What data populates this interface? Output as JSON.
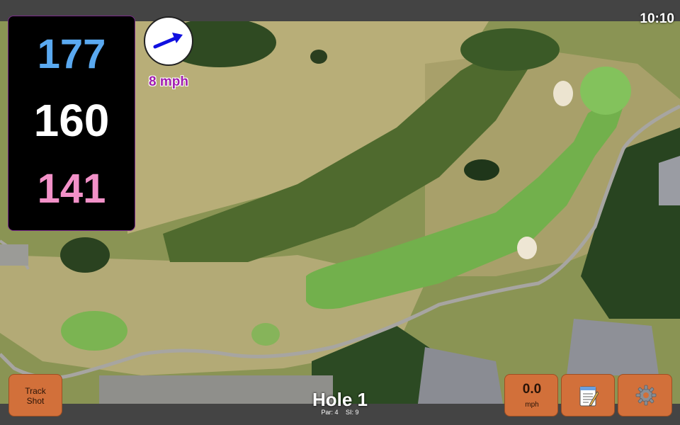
{
  "status": {
    "time": "10:10"
  },
  "distances": {
    "back": "177",
    "middle": "160",
    "front": "141",
    "back_color": "#5aa9f0",
    "middle_color": "#ffffff",
    "front_color": "#f291c8"
  },
  "wind": {
    "speed_label": "8 mph",
    "speed_color": "#a01bb0",
    "arrow_color": "#1010e0",
    "icon": "wind-direction-arrow-icon"
  },
  "buttons": {
    "track_shot_line1": "Track",
    "track_shot_line2": "Shot",
    "wind_value": "0.0",
    "wind_unit": "mph",
    "notes_icon": "notepad-icon",
    "settings_icon": "gear-icon",
    "button_color": "#d2703a"
  },
  "hole": {
    "title": "Hole 1",
    "par": "Par: 4",
    "si": "SI: 9"
  }
}
